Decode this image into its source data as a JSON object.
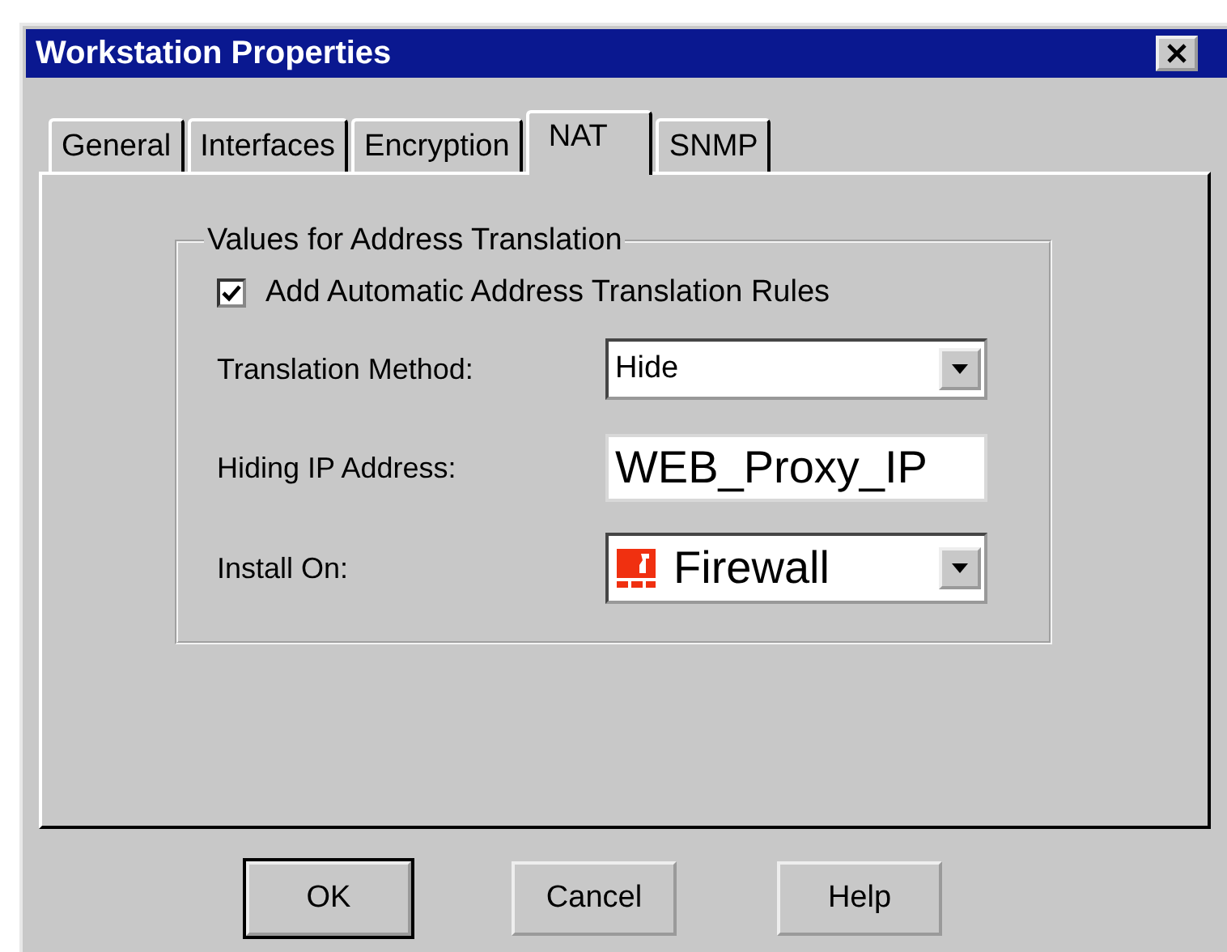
{
  "window": {
    "title": "Workstation Properties"
  },
  "tabs": [
    {
      "label": "General",
      "selected": false
    },
    {
      "label": "Interfaces",
      "selected": false
    },
    {
      "label": "Encryption",
      "selected": false
    },
    {
      "label": "NAT",
      "selected": true
    },
    {
      "label": "SNMP",
      "selected": false
    }
  ],
  "group": {
    "title": "Values for  Address Translation",
    "checkbox": {
      "label": "Add Automatic Address Translation Rules",
      "checked": true
    },
    "fields": [
      {
        "label": "Translation Method:",
        "kind": "combo",
        "value": "Hide"
      },
      {
        "label": "Hiding IP Address:",
        "kind": "text",
        "value": "WEB_Proxy_IP"
      },
      {
        "label": "Install On:",
        "kind": "object-combo",
        "value": "Firewall"
      }
    ]
  },
  "buttons": [
    {
      "label": "OK",
      "default": true
    },
    {
      "label": "Cancel",
      "default": false
    },
    {
      "label": "Help",
      "default": false
    }
  ]
}
